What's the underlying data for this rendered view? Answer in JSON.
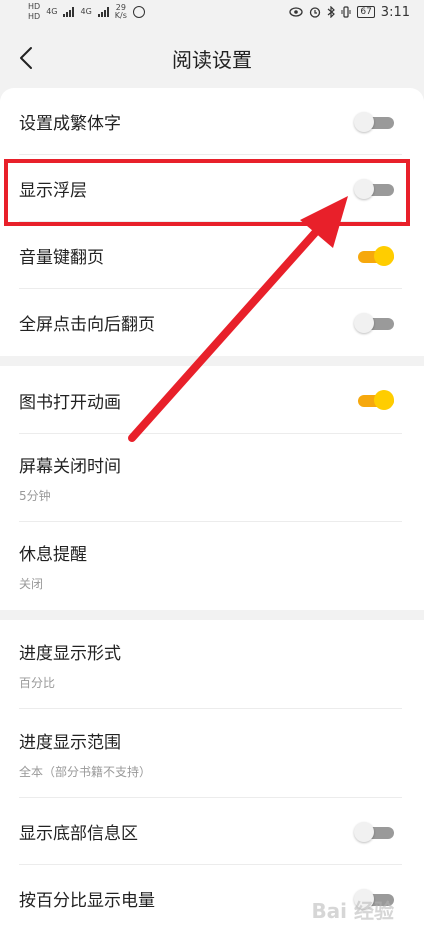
{
  "status_bar": {
    "net_small_1": "HD",
    "net_small_2": "HD",
    "net_4g_1": "4G",
    "net_4g_2": "4G",
    "speed_value": "29",
    "speed_unit": "K/s",
    "battery": "67",
    "time": "3:11"
  },
  "header": {
    "title": "阅读设置"
  },
  "group1": [
    {
      "label": "设置成繁体字",
      "toggle": "off"
    },
    {
      "label": "显示浮层",
      "toggle": "off"
    },
    {
      "label": "音量键翻页",
      "toggle": "on"
    },
    {
      "label": "全屏点击向后翻页",
      "toggle": "off"
    }
  ],
  "group2": [
    {
      "label": "图书打开动画",
      "toggle": "on"
    },
    {
      "label": "屏幕关闭时间",
      "value": "5分钟"
    },
    {
      "label": "休息提醒",
      "value": "关闭"
    }
  ],
  "group3": [
    {
      "label": "进度显示形式",
      "value": "百分比"
    },
    {
      "label": "进度显示范围",
      "value": "全本（部分书籍不支持）"
    },
    {
      "label": "显示底部信息区",
      "toggle": "off"
    },
    {
      "label": "按百分比显示电量",
      "toggle": "off"
    }
  ],
  "watermark": "Bai 经验",
  "colors": {
    "toggle_on_track": "#f6a80d",
    "toggle_on_thumb": "#ffcd00",
    "toggle_off_track": "#9a9a9a",
    "annotation_red": "#e8202a"
  }
}
